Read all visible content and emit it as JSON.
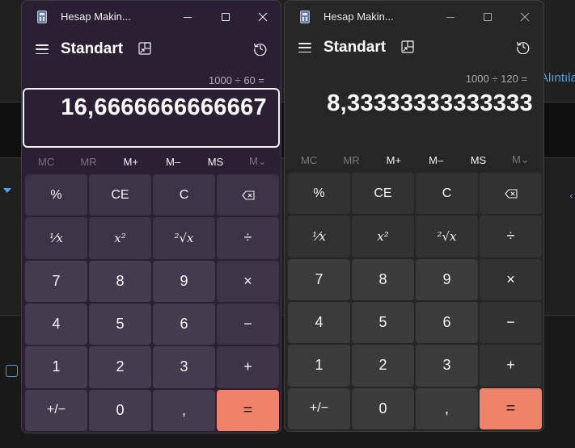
{
  "background": {
    "link_fragment": "Alıntıla"
  },
  "windows": [
    {
      "title": "Hesap Makin...",
      "mode": "Standart",
      "expression": "1000 ÷ 60 =",
      "result": "16,6666666666667",
      "memory": [
        "MC",
        "MR",
        "M+",
        "M–",
        "MS",
        "M⌄"
      ],
      "keys": [
        "%",
        "CE",
        "C",
        "⌫",
        "⅟x",
        "x²",
        "²√x",
        "÷",
        "7",
        "8",
        "9",
        "×",
        "4",
        "5",
        "6",
        "−",
        "1",
        "2",
        "3",
        "+",
        "+/−",
        "0",
        ",",
        "="
      ]
    },
    {
      "title": "Hesap Makin...",
      "mode": "Standart",
      "expression": "1000 ÷ 120 =",
      "result": "8,33333333333333",
      "memory": [
        "MC",
        "MR",
        "M+",
        "M–",
        "MS",
        "M⌄"
      ],
      "keys": [
        "%",
        "CE",
        "C",
        "⌫",
        "⅟x",
        "x²",
        "²√x",
        "÷",
        "7",
        "8",
        "9",
        "×",
        "4",
        "5",
        "6",
        "−",
        "1",
        "2",
        "3",
        "+",
        "+/−",
        "0",
        ",",
        "="
      ]
    }
  ],
  "colors": {
    "left_window_bg": "#2b1f33",
    "right_window_bg": "#262626",
    "equals_accent": "#f0826a",
    "link_blue": "#4aa7ec"
  },
  "icons": {
    "app": "calculator-icon",
    "minimize": "minimize-icon",
    "maximize": "maximize-icon",
    "close": "close-icon",
    "menu": "hamburger-icon",
    "keep_on_top": "keep-on-top-icon",
    "history": "history-icon"
  }
}
